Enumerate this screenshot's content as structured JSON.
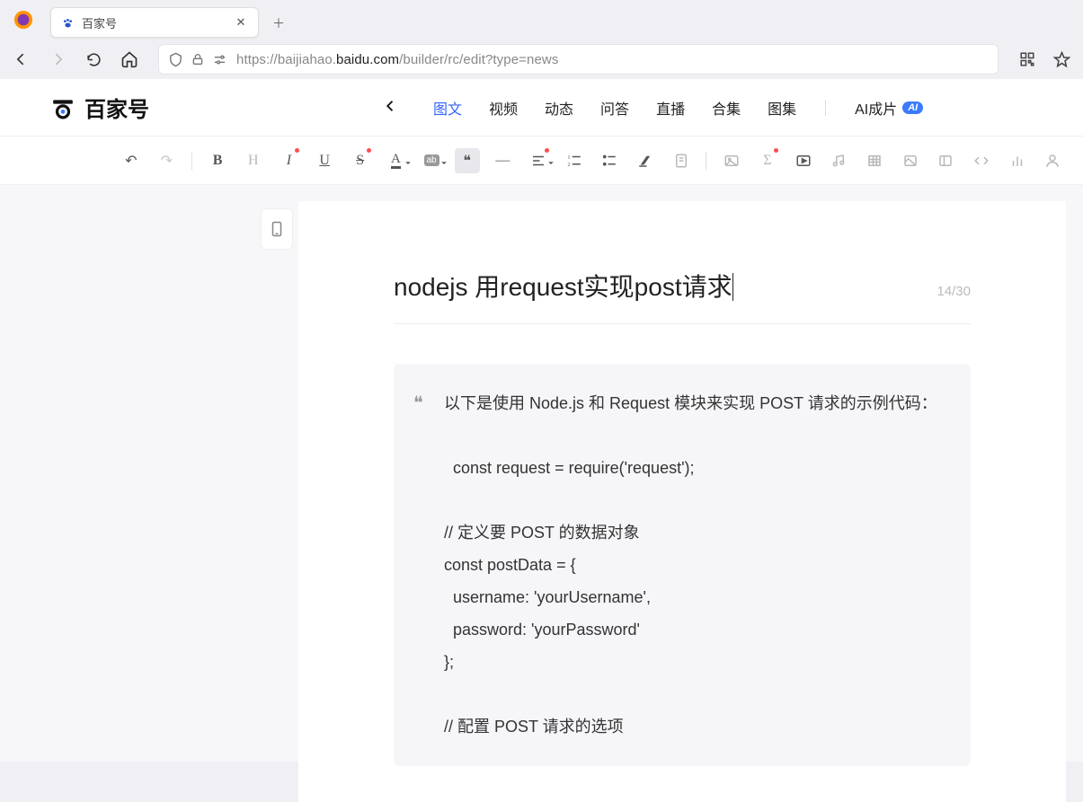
{
  "browser": {
    "tab_title": "百家号",
    "url_prefix": "https://baijiahao.",
    "url_bold": "baidu.com",
    "url_suffix": "/builder/rc/edit?type=news"
  },
  "header": {
    "logo_text": "百家号",
    "tabs": [
      "图文",
      "视频",
      "动态",
      "问答",
      "直播",
      "合集",
      "图集"
    ],
    "active_tab_index": 0,
    "ai_label": "AI成片",
    "ai_badge": "AI"
  },
  "toolbar": {
    "items": [
      {
        "name": "undo",
        "glyph": "↶"
      },
      {
        "name": "redo",
        "glyph": "↷",
        "disabled": true
      },
      {
        "name": "sep"
      },
      {
        "name": "bold",
        "glyph": "B"
      },
      {
        "name": "heading",
        "glyph": "H",
        "muted": true
      },
      {
        "name": "italic",
        "glyph": "I",
        "dot": true
      },
      {
        "name": "underline",
        "glyph": "U"
      },
      {
        "name": "strike",
        "glyph": "S",
        "dot": true
      },
      {
        "name": "font-color",
        "glyph": "A",
        "drop": true
      },
      {
        "name": "bg-color",
        "glyph": "ab",
        "badge": true,
        "drop": true
      },
      {
        "name": "quote",
        "glyph": "❝",
        "active": true
      },
      {
        "name": "hr",
        "glyph": "—"
      },
      {
        "name": "align",
        "glyph": "align",
        "drop": true,
        "dot": true
      },
      {
        "name": "ol",
        "glyph": "ol"
      },
      {
        "name": "ul",
        "glyph": "ul"
      },
      {
        "name": "clear",
        "glyph": "clear"
      },
      {
        "name": "attach",
        "glyph": "attach",
        "muted": true
      },
      {
        "name": "sep"
      },
      {
        "name": "image",
        "glyph": "img",
        "muted": true
      },
      {
        "name": "formula",
        "glyph": "Σ",
        "dot": true,
        "muted": true
      },
      {
        "name": "video",
        "glyph": "video"
      },
      {
        "name": "audio",
        "glyph": "audio",
        "muted": true
      },
      {
        "name": "table",
        "glyph": "table",
        "muted": true
      },
      {
        "name": "card",
        "glyph": "card",
        "muted": true
      },
      {
        "name": "sidebar",
        "glyph": "sb",
        "muted": true
      },
      {
        "name": "code",
        "glyph": "code",
        "muted": true
      },
      {
        "name": "chart",
        "glyph": "chart",
        "muted": true
      },
      {
        "name": "user",
        "glyph": "user",
        "muted": true
      }
    ]
  },
  "editor": {
    "title": "nodejs 用request实现post请求",
    "char_count": "14/30",
    "quote_lines": [
      "以下是使用 Node.js 和 Request 模块来实现 POST 请求的示例代码：",
      "",
      "  const request = require('request');",
      "",
      "// 定义要 POST 的数据对象",
      "const postData = {",
      "  username: 'yourUsername',",
      "  password: 'yourPassword'",
      "};",
      "",
      "// 配置 POST 请求的选项"
    ]
  }
}
